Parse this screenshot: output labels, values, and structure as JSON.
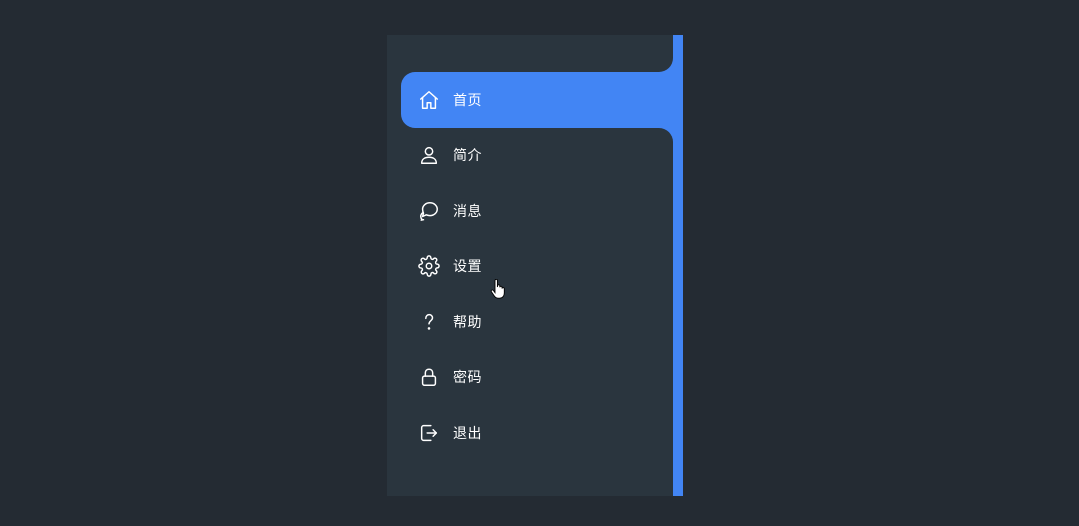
{
  "menu": {
    "items": [
      {
        "label": "首页",
        "icon": "home-icon",
        "active": true
      },
      {
        "label": "简介",
        "icon": "user-icon",
        "active": false
      },
      {
        "label": "消息",
        "icon": "chat-icon",
        "active": false
      },
      {
        "label": "设置",
        "icon": "gear-icon",
        "active": false
      },
      {
        "label": "帮助",
        "icon": "help-icon",
        "active": false
      },
      {
        "label": "密码",
        "icon": "lock-icon",
        "active": false
      },
      {
        "label": "退出",
        "icon": "logout-icon",
        "active": false
      }
    ]
  },
  "colors": {
    "background": "#242b33",
    "sidebar": "#2a353e",
    "accent": "#4285f4",
    "text": "#ffffff"
  }
}
